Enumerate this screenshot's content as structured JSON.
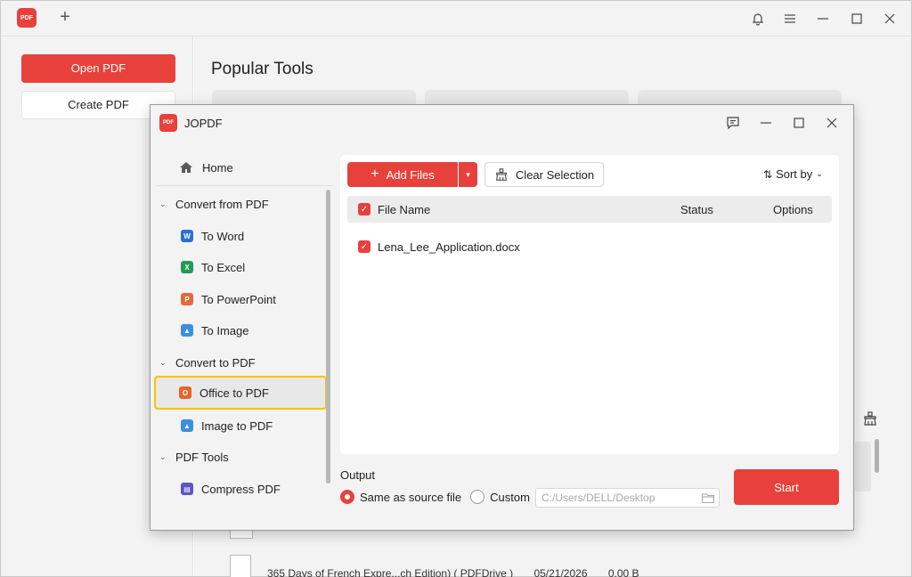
{
  "app": {
    "logo_text": "PDF",
    "new_tab": "+"
  },
  "left_panel": {
    "open_pdf": "Open PDF",
    "create_pdf": "Create PDF"
  },
  "content": {
    "popular_tools_title": "Popular Tools",
    "recent_file": {
      "name": "365 Days of French Expre...ch Edition) ( PDFDrive )",
      "date": "05/21/2026",
      "size": "0.00 B"
    }
  },
  "dialog": {
    "title": "JOPDF",
    "logo_text": "PDF",
    "sidebar": {
      "home": "Home",
      "groups": [
        {
          "label": "Convert from PDF",
          "items": [
            {
              "label": "To Word",
              "icon_letter": "W",
              "color": "#2b6fd6"
            },
            {
              "label": "To Excel",
              "icon_letter": "X",
              "color": "#1f9d55"
            },
            {
              "label": "To PowerPoint",
              "icon_letter": "P",
              "color": "#e36a3a"
            },
            {
              "label": "To Image",
              "icon_letter": "▲",
              "color": "#3b8fe0"
            }
          ]
        },
        {
          "label": "Convert to PDF",
          "items": [
            {
              "label": "Office to PDF",
              "icon_letter": "O",
              "color": "#e8632b"
            },
            {
              "label": "Image to PDF",
              "icon_letter": "▲",
              "color": "#3b8fe0"
            }
          ]
        },
        {
          "label": "PDF Tools",
          "items": [
            {
              "label": "Compress PDF",
              "icon_letter": "▤",
              "color": "#5b55c8"
            }
          ]
        }
      ]
    },
    "toolbar": {
      "add_files": "Add Files",
      "clear_selection": "Clear Selection",
      "sort_by": "Sort by"
    },
    "table": {
      "headers": {
        "name": "File Name",
        "status": "Status",
        "options": "Options"
      },
      "rows": [
        {
          "name": "Lena_Lee_Application.docx",
          "status": "",
          "checked": true
        }
      ]
    },
    "output": {
      "label": "Output",
      "options": [
        "Same as source file",
        "Custom"
      ],
      "selected": "Same as source file",
      "path_placeholder": "C:/Users/DELL/Desktop"
    },
    "start": "Start"
  },
  "colors": {
    "accent": "#e8413b",
    "highlight": "#f5c400"
  }
}
